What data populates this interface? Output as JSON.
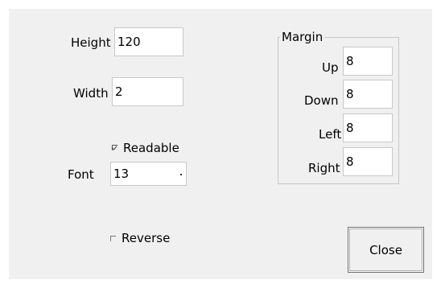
{
  "form": {
    "height_label": "Height",
    "height_value": "120",
    "width_label": "Width",
    "width_value": "2",
    "readable_label": "Readable",
    "readable_checked": true,
    "font_label": "Font",
    "font_value": "13",
    "reverse_label": "Reverse",
    "reverse_checked": false
  },
  "margin": {
    "title": "Margin",
    "up_label": "Up",
    "up_value": "8",
    "down_label": "Down",
    "down_value": "8",
    "left_label": "Left",
    "left_value": "8",
    "right_label": "Right",
    "right_value": "8"
  },
  "actions": {
    "close_label": "Close"
  }
}
